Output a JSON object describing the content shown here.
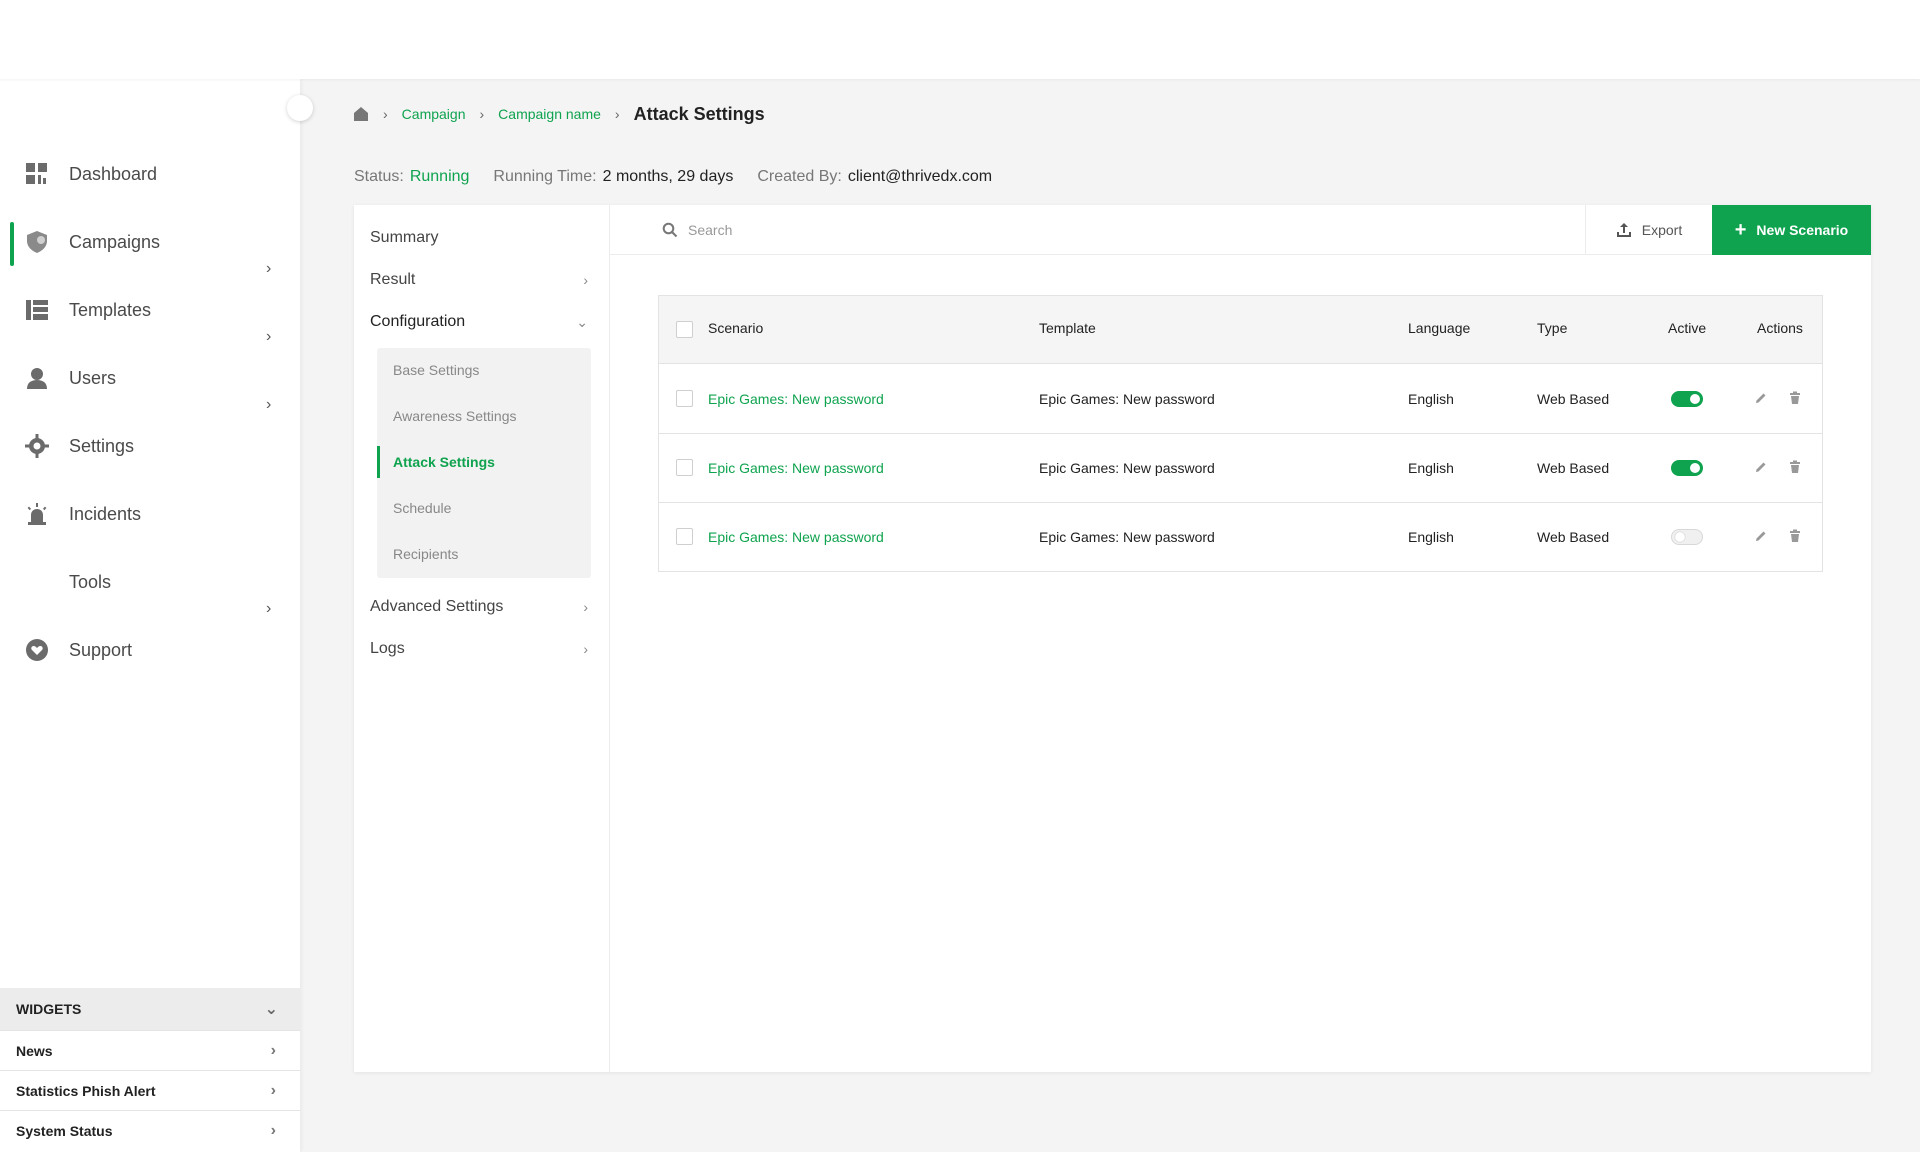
{
  "sidebar": {
    "items": [
      {
        "label": "Dashboard",
        "icon": "dashboard-icon",
        "has_submenu": false
      },
      {
        "label": "Campaigns",
        "icon": "shield-icon",
        "has_submenu": true,
        "active": true
      },
      {
        "label": "Templates",
        "icon": "templates-icon",
        "has_submenu": true
      },
      {
        "label": "Users",
        "icon": "user-icon",
        "has_submenu": true
      },
      {
        "label": "Settings",
        "icon": "gear-icon",
        "has_submenu": false
      },
      {
        "label": "Incidents",
        "icon": "alarm-icon",
        "has_submenu": false
      },
      {
        "label": "Tools",
        "icon": "",
        "has_submenu": true
      },
      {
        "label": "Support",
        "icon": "heart-icon",
        "has_submenu": false
      }
    ],
    "widgets": {
      "title": "WIDGETS",
      "rows": [
        "News",
        "Statistics Phish Alert",
        "System Status"
      ]
    }
  },
  "breadcrumb": {
    "items": [
      "Campaign",
      "Campaign name"
    ],
    "current": "Attack Settings"
  },
  "status": {
    "status_label": "Status:",
    "status_value": "Running",
    "running_time_label": "Running Time:",
    "running_time_value": "2 months, 29 days",
    "created_by_label": "Created By:",
    "created_by_value": "client@thrivedx.com"
  },
  "subnav": {
    "items": [
      {
        "label": "Summary"
      },
      {
        "label": "Result"
      },
      {
        "label": "Configuration"
      },
      {
        "label": "Advanced Settings"
      },
      {
        "label": "Logs"
      }
    ],
    "config_children": [
      "Base Settings",
      "Awareness Settings",
      "Attack Settings",
      "Schedule",
      "Recipients"
    ]
  },
  "toolbar": {
    "search_placeholder": "Search",
    "export_label": "Export",
    "new_label": "New Scenario"
  },
  "table": {
    "columns": [
      "Scenario",
      "Template",
      "Language",
      "Type",
      "Active",
      "Actions"
    ],
    "rows": [
      {
        "scenario": "Epic Games: New password",
        "template": "Epic Games: New password",
        "language": "English",
        "type": "Web Based",
        "active": true
      },
      {
        "scenario": "Epic Games: New password",
        "template": "Epic Games: New password",
        "language": "English",
        "type": "Web Based",
        "active": true
      },
      {
        "scenario": "Epic Games: New password",
        "template": "Epic Games: New password",
        "language": "English",
        "type": "Web Based",
        "active": false
      }
    ]
  },
  "colors": {
    "accent": "#0fa34f"
  }
}
